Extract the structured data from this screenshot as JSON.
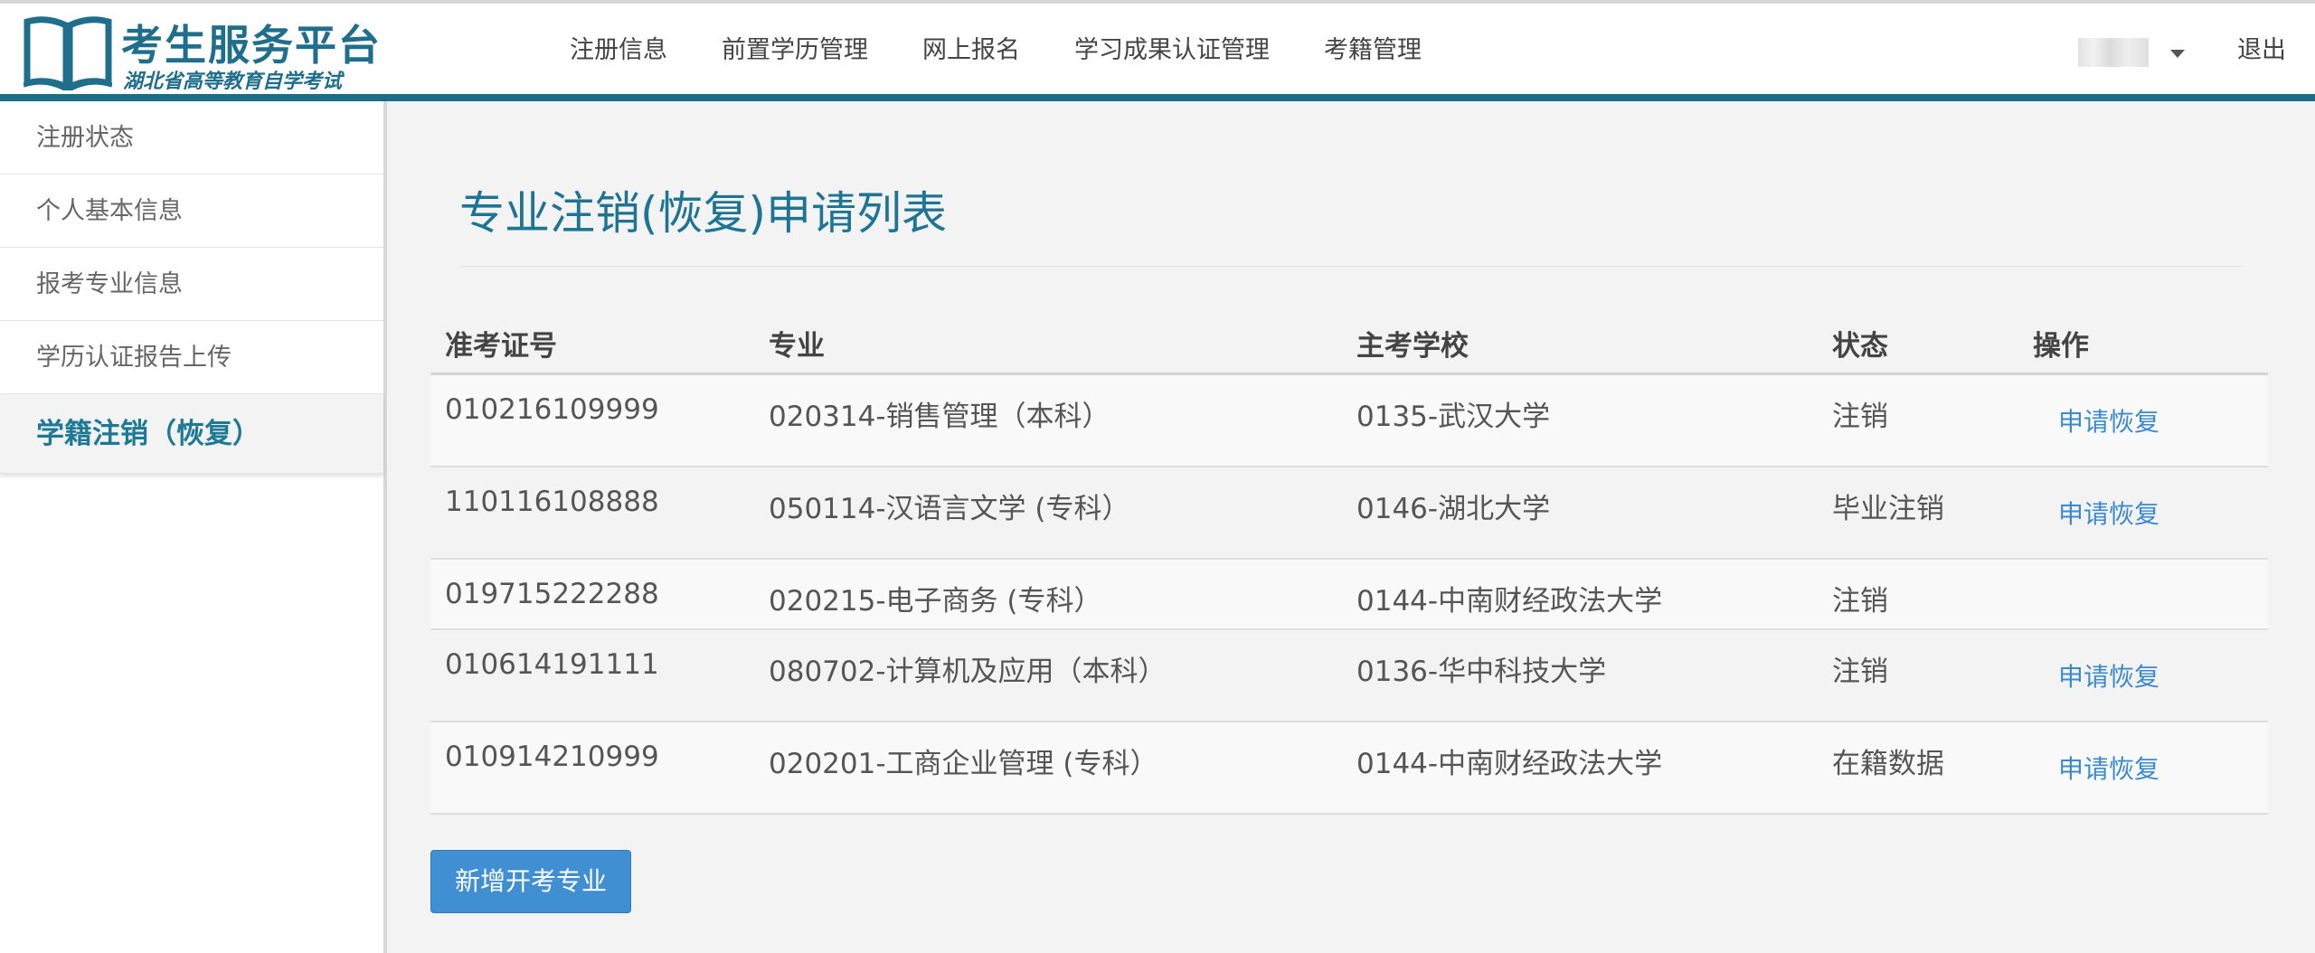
{
  "app": {
    "title": "考生服务平台",
    "subtitle": "湖北省高等教育自学考试"
  },
  "nav": {
    "items": [
      "注册信息",
      "前置学历管理",
      "网上报名",
      "学习成果认证管理",
      "考籍管理"
    ],
    "logout": "退出"
  },
  "sidebar": {
    "items": [
      {
        "label": "注册状态",
        "active": false
      },
      {
        "label": "个人基本信息",
        "active": false
      },
      {
        "label": "报考专业信息",
        "active": false
      },
      {
        "label": "学历认证报告上传",
        "active": false
      },
      {
        "label": "学籍注销（恢复）",
        "active": true
      }
    ]
  },
  "main": {
    "title": "专业注销(恢复)申请列表",
    "table": {
      "headers": [
        "准考证号",
        "专业",
        "主考学校",
        "状态",
        "操作"
      ],
      "rows": [
        {
          "id": "010216109999",
          "major": "020314-销售管理（本科）",
          "school": "0135-武汉大学",
          "status": "注销",
          "action": "申请恢复"
        },
        {
          "id": "110116108888",
          "major": "050114-汉语言文学 (专科）",
          "school": "0146-湖北大学",
          "status": "毕业注销",
          "action": "申请恢复"
        },
        {
          "id": "019715222288",
          "major": "020215-电子商务 (专科）",
          "school": "0144-中南财经政法大学",
          "status": "注销",
          "action": ""
        },
        {
          "id": "010614191111",
          "major": "080702-计算机及应用（本科）",
          "school": "0136-华中科技大学",
          "status": "注销",
          "action": "申请恢复"
        },
        {
          "id": "010914210999",
          "major": "020201-工商企业管理 (专科）",
          "school": "0144-中南财经政法大学",
          "status": "在籍数据",
          "action": "申请恢复"
        }
      ]
    },
    "add_button": "新增开考专业"
  },
  "colors": {
    "brand": "#1f6e8c",
    "header_rule": "#1a6f86",
    "link": "#3a8ad0",
    "button": "#3f8fd2"
  },
  "icons": {
    "logo": "open-book-icon",
    "user_menu": "caret-down-icon"
  }
}
